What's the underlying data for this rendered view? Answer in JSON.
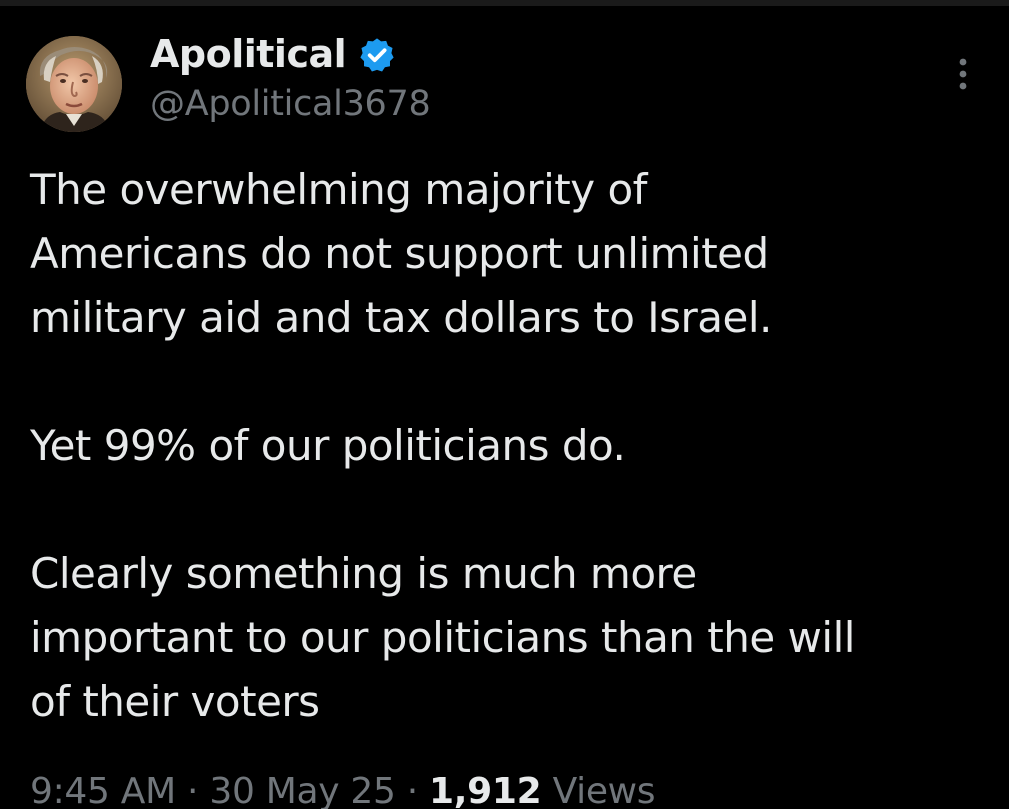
{
  "tweet": {
    "author": {
      "display_name": "Apolitical",
      "handle": "@Apolitical3678",
      "verified": true,
      "avatar_icon": "portrait-avatar"
    },
    "menu_icon": "more-vertical-icon",
    "paragraphs": [
      [
        "The overwhelming majority of",
        "Americans do not support unlimited",
        "military aid and tax dollars to Israel."
      ],
      [
        "Yet 99% of our politicians do."
      ],
      [
        "Clearly something is much more",
        "important to our politicians than the will",
        "of their voters"
      ]
    ],
    "meta": {
      "time": "9:45 AM",
      "separator": "·",
      "date": "30 May 25",
      "views_count": "1,912",
      "views_label": "Views"
    }
  },
  "colors": {
    "background": "#000000",
    "text_primary": "#e7e9ea",
    "text_secondary": "#71767b",
    "verified_blue": "#1d9bf0"
  }
}
